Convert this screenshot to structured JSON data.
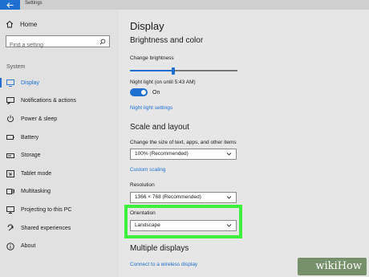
{
  "window": {
    "title": "Settings"
  },
  "sidebar": {
    "home_label": "Home",
    "search_placeholder": "Find a setting",
    "section_label": "System",
    "items": [
      {
        "label": "Display",
        "icon": "monitor-icon",
        "active": true
      },
      {
        "label": "Notifications & actions",
        "icon": "notifications-icon"
      },
      {
        "label": "Power & sleep",
        "icon": "power-icon"
      },
      {
        "label": "Battery",
        "icon": "battery-icon"
      },
      {
        "label": "Storage",
        "icon": "storage-icon"
      },
      {
        "label": "Tablet mode",
        "icon": "tablet-icon"
      },
      {
        "label": "Multitasking",
        "icon": "multitasking-icon"
      },
      {
        "label": "Projecting to this PC",
        "icon": "projecting-icon"
      },
      {
        "label": "Shared experiences",
        "icon": "shared-experiences-icon"
      },
      {
        "label": "About",
        "icon": "info-icon"
      }
    ]
  },
  "main": {
    "title": "Display",
    "brightness": {
      "heading": "Brightness and color",
      "change_label": "Change brightness",
      "level": 0.4,
      "night_light_label": "Night light (on until 5:43 AM)",
      "night_light_state": "On",
      "night_light_link": "Night light settings"
    },
    "scale": {
      "heading": "Scale and layout",
      "size_label": "Change the size of text, apps, and other items",
      "size_value": "100% (Recommended)",
      "custom_link": "Custom scaling",
      "resolution_label": "Resolution",
      "resolution_value": "1366 × 768 (Recommended)",
      "orientation_label": "Orientation",
      "orientation_value": "Landscape"
    },
    "multiple": {
      "heading": "Multiple displays",
      "link": "Connect to a wireless display"
    }
  },
  "watermark": {
    "text": "wikiHow"
  },
  "colors": {
    "accent": "#1f6fd0",
    "highlight": "#3cf03c"
  }
}
